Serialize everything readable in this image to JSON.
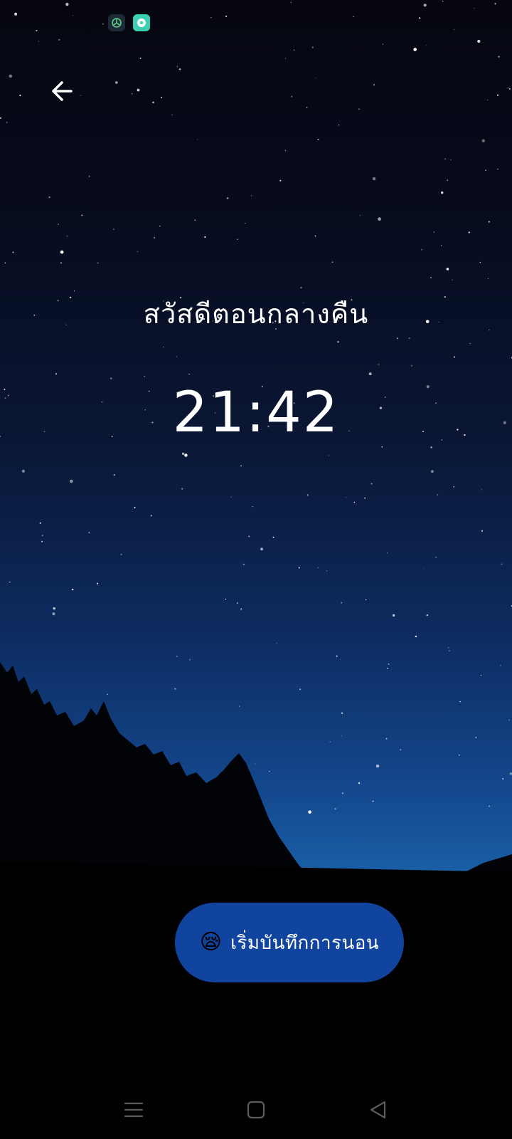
{
  "status_bar": {
    "apps": [
      {
        "icon": "shield-app-icon",
        "color": "#1d2a36"
      },
      {
        "icon": "chat-app-icon",
        "color": "#3ccfb1"
      }
    ]
  },
  "header": {
    "back_icon": "arrow-left-icon"
  },
  "main": {
    "greeting": "สวัสดีตอนกลางคืน",
    "time": "21:42"
  },
  "action": {
    "emoji": "😪",
    "label": "เริ่มบันทึกการนอน",
    "color": "#11449e"
  },
  "navigation": {
    "items": [
      {
        "icon": "menu-icon"
      },
      {
        "icon": "home-square-icon"
      },
      {
        "icon": "back-triangle-icon"
      }
    ]
  }
}
